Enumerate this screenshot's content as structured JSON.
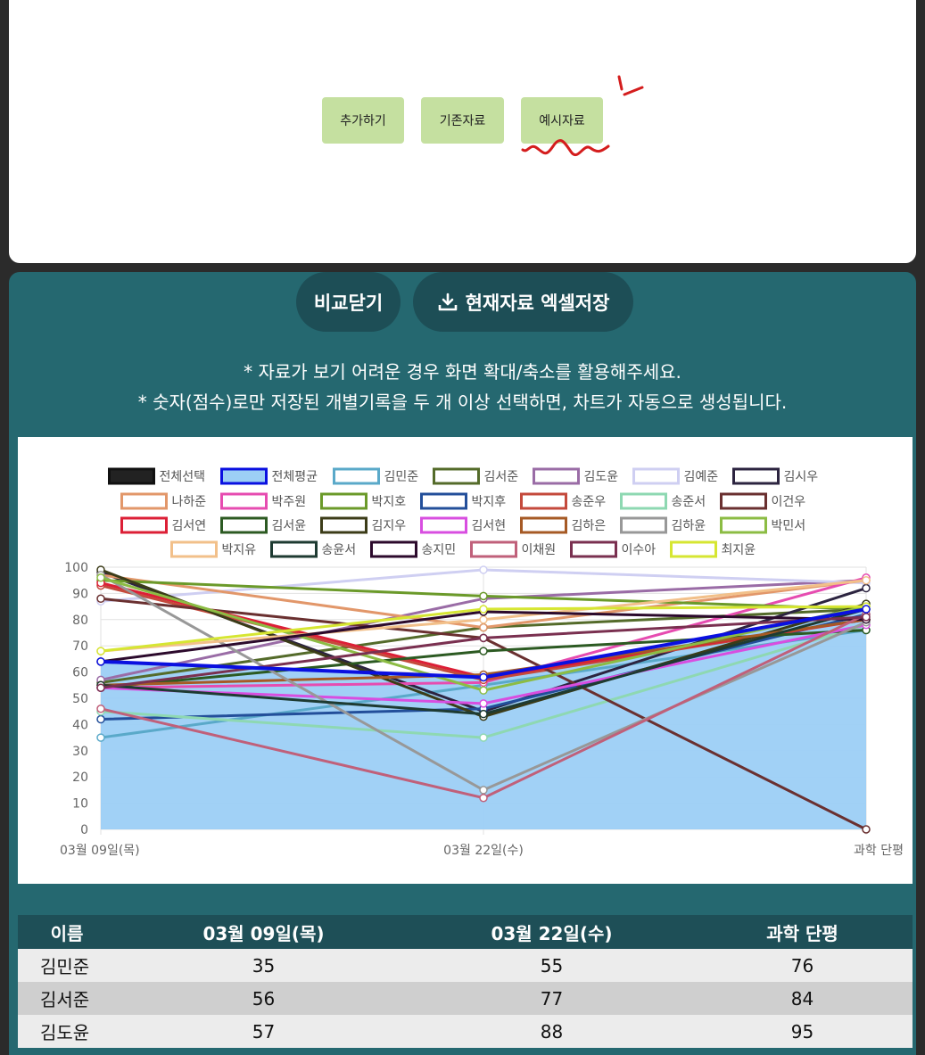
{
  "top_buttons": {
    "add": "추가하기",
    "existing": "기존자료",
    "example": "예시자료"
  },
  "actions": {
    "close_compare": "비교닫기",
    "excel_save": "현재자료 엑셀저장"
  },
  "notes": {
    "line1": "* 자료가 보기 어려운 경우 화면 확대/축소를 활용해주세요.",
    "line2": "* 숫자(점수)로만 저장된 개별기록을 두 개 이상 선택하면, 차트가 자동으로 생성됩니다."
  },
  "chart_data": {
    "type": "line",
    "categories": [
      "03월 09일(목)",
      "03월 22일(수)",
      "과학 단평"
    ],
    "ylim": [
      0,
      100
    ],
    "yticks": [
      0,
      10,
      20,
      30,
      40,
      50,
      60,
      70,
      80,
      90,
      100
    ],
    "grid": true,
    "legend_position": "top",
    "series": [
      {
        "name": "전체선택",
        "color": "#111111",
        "values": [
          null,
          null,
          null
        ]
      },
      {
        "name": "전체평균",
        "color": "#0a10e0",
        "fill": "#9ccff5",
        "values": [
          64,
          58,
          84
        ]
      },
      {
        "name": "김민준",
        "color": "#5aa9c9",
        "values": [
          35,
          55,
          76
        ]
      },
      {
        "name": "김서준",
        "color": "#546b2a",
        "values": [
          56,
          77,
          84
        ]
      },
      {
        "name": "김도윤",
        "color": "#9a6ca6",
        "values": [
          57,
          88,
          95
        ]
      },
      {
        "name": "김예준",
        "color": "#cfcff2",
        "values": [
          87,
          99,
          94
        ]
      },
      {
        "name": "김시우",
        "color": "#2c2440",
        "values": [
          98,
          45,
          92
        ]
      },
      {
        "name": "나하준",
        "color": "#e2976a",
        "values": [
          97,
          77,
          95
        ]
      },
      {
        "name": "박주원",
        "color": "#e64cb0",
        "values": [
          54,
          56,
          96
        ]
      },
      {
        "name": "박지호",
        "color": "#6b9a2a",
        "values": [
          95,
          89,
          84
        ]
      },
      {
        "name": "박지후",
        "color": "#234f9a",
        "values": [
          42,
          46,
          82
        ]
      },
      {
        "name": "송준우",
        "color": "#c44a3c",
        "values": [
          93,
          57,
          80
        ]
      },
      {
        "name": "송준서",
        "color": "#8ed8b2",
        "values": [
          45,
          35,
          78
        ]
      },
      {
        "name": "이건우",
        "color": "#6a3030",
        "values": [
          88,
          73,
          0
        ]
      },
      {
        "name": "김서연",
        "color": "#dc1f36",
        "values": [
          94,
          58,
          80
        ]
      },
      {
        "name": "김서윤",
        "color": "#2c5a22",
        "values": [
          54,
          68,
          76
        ]
      },
      {
        "name": "김지우",
        "color": "#3c3c18",
        "values": [
          99,
          43,
          86
        ]
      },
      {
        "name": "김서현",
        "color": "#d84ee0",
        "values": [
          54,
          48,
          78
        ]
      },
      {
        "name": "김하은",
        "color": "#a65a25",
        "values": [
          55,
          59,
          80
        ]
      },
      {
        "name": "김하윤",
        "color": "#989898",
        "values": [
          97,
          15,
          79
        ]
      },
      {
        "name": "박민서",
        "color": "#8cbc44",
        "values": [
          96,
          53,
          85
        ]
      },
      {
        "name": "박지유",
        "color": "#f2c08a",
        "values": [
          68,
          80,
          95
        ]
      },
      {
        "name": "송윤서",
        "color": "#1e3b32",
        "values": [
          55,
          44,
          84
        ]
      },
      {
        "name": "송지민",
        "color": "#2c0a2c",
        "values": [
          64,
          83,
          80
        ]
      },
      {
        "name": "이채원",
        "color": "#c0607a",
        "values": [
          46,
          12,
          82
        ]
      },
      {
        "name": "이수아",
        "color": "#7a3050",
        "values": [
          54,
          73,
          81
        ]
      },
      {
        "name": "최지윤",
        "color": "#d6e632",
        "values": [
          68,
          84,
          85
        ]
      }
    ]
  },
  "table": {
    "headers": [
      "이름",
      "03월 09일(목)",
      "03월 22일(수)",
      "과학 단평"
    ],
    "rows": [
      [
        "김민준",
        "35",
        "55",
        "76"
      ],
      [
        "김서준",
        "56",
        "77",
        "84"
      ],
      [
        "김도윤",
        "57",
        "88",
        "95"
      ]
    ]
  }
}
